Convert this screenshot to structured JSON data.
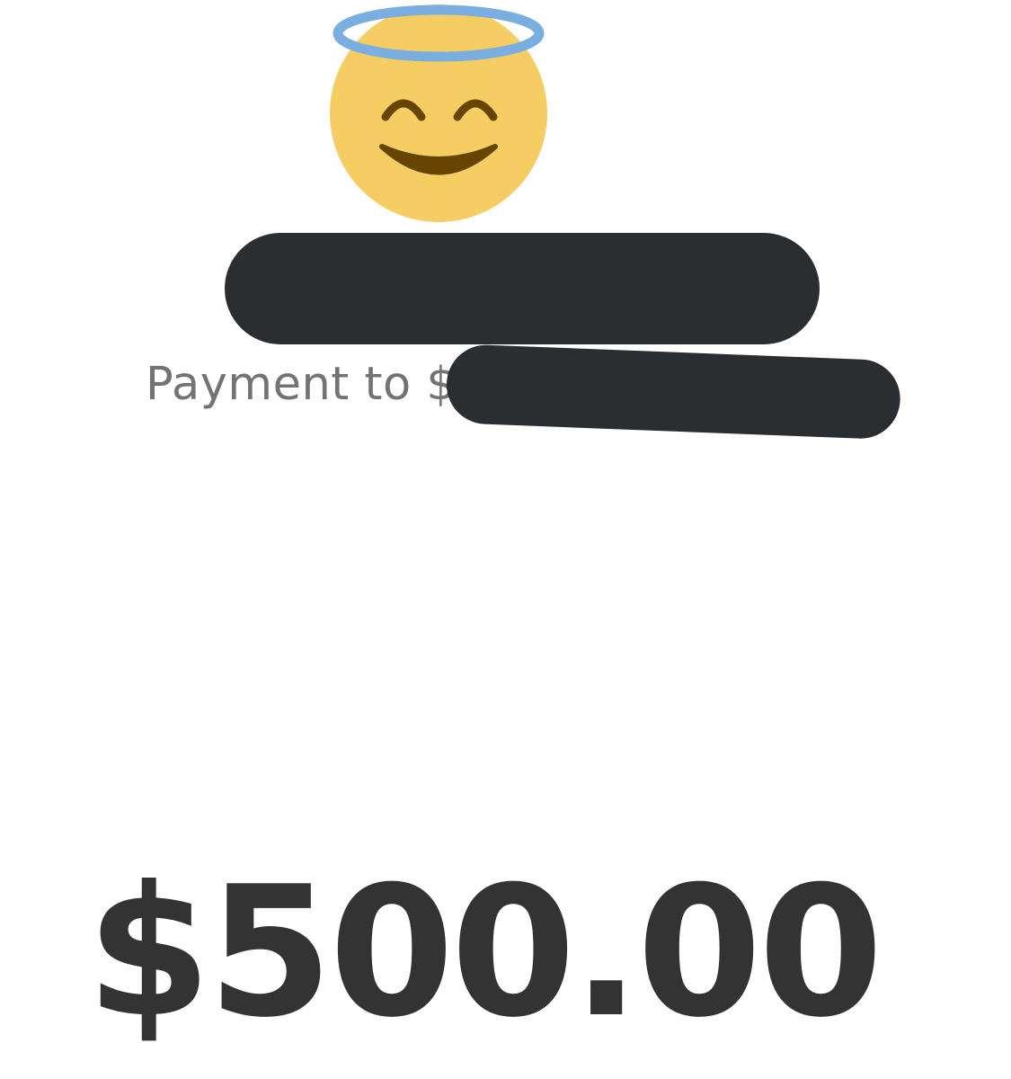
{
  "payment": {
    "label": "Payment to $",
    "amount": "$500.00"
  },
  "avatar": {
    "icon": "smiling-face-with-halo-icon"
  },
  "redactions": {
    "name": "",
    "cashtag": ""
  },
  "colors": {
    "background": "#ffffff",
    "face": "#f5cd62",
    "halo": "#7aaee0",
    "features": "#664500",
    "redaction": "#2b2e31",
    "label": "#737373",
    "amount": "#333333"
  }
}
